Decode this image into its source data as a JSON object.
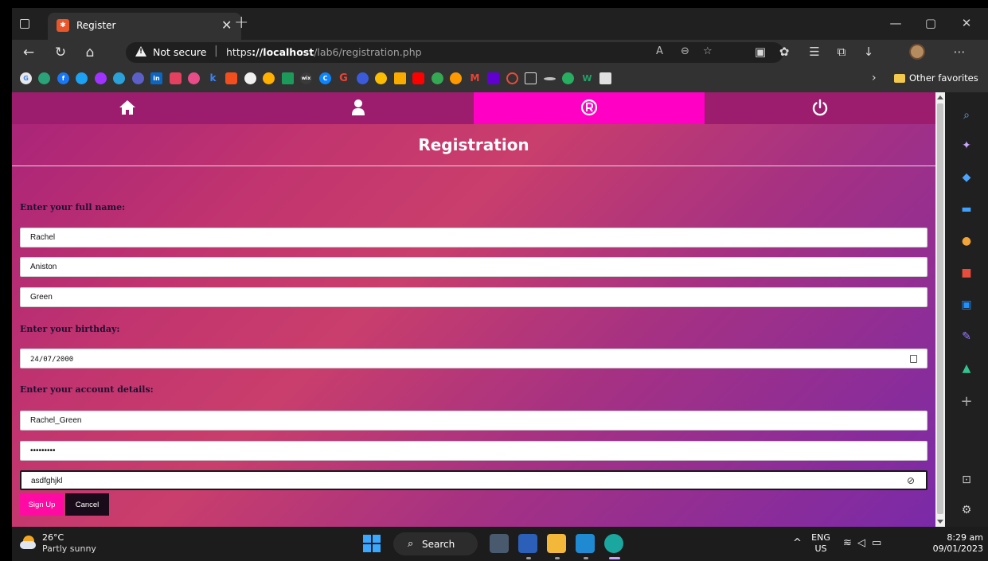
{
  "browser": {
    "tab": {
      "title": "Register",
      "favicon": "XAMPP",
      "close_glyph": "✕"
    },
    "new_tab_glyph": "+",
    "window_controls": {
      "minimize": "—",
      "restore": "▢",
      "close": "✕"
    },
    "nav": {
      "back": "←",
      "refresh": "↻",
      "home": "⌂"
    },
    "address": {
      "warning_label": "Not secure",
      "separator": "|",
      "url_scheme": "https",
      "url_host": "://localhost",
      "url_path": "/lab6/registration.php"
    },
    "favorites": {
      "chevron": "›",
      "other_label": "Other favorites"
    }
  },
  "page": {
    "nav_items": [
      {
        "name": "home-icon",
        "glyph": "⌂"
      },
      {
        "name": "user-icon",
        "glyph": "👤"
      },
      {
        "name": "registered-icon",
        "glyph": "®"
      },
      {
        "name": "power-icon",
        "glyph": "⏻"
      }
    ],
    "active_nav_index": 2,
    "title": "Registration",
    "sections": {
      "name_label": "Enter your full name:",
      "birthday_label": "Enter your birthday:",
      "account_label": "Enter your account details:"
    },
    "fields": {
      "first_name": "Rachel",
      "middle_name": "Aniston",
      "last_name": "Green",
      "birthday": "24/07/2000",
      "username": "Rachel_Green",
      "password_masked": "•••••••••",
      "password_confirm": "asdfghjkl"
    },
    "buttons": {
      "signup": "Sign Up",
      "cancel": "Cancel"
    },
    "colors": {
      "nav_active": "#ff00c4",
      "signup_button": "#ff0aa3",
      "cancel_button": "#1a0b1a"
    }
  },
  "taskbar": {
    "weather_temp": "26°C",
    "weather_desc": "Partly sunny",
    "search_label": "Search",
    "lang_top": "ENG",
    "lang_bottom": "US",
    "time": "8:29 am",
    "date": "09/01/2023"
  }
}
